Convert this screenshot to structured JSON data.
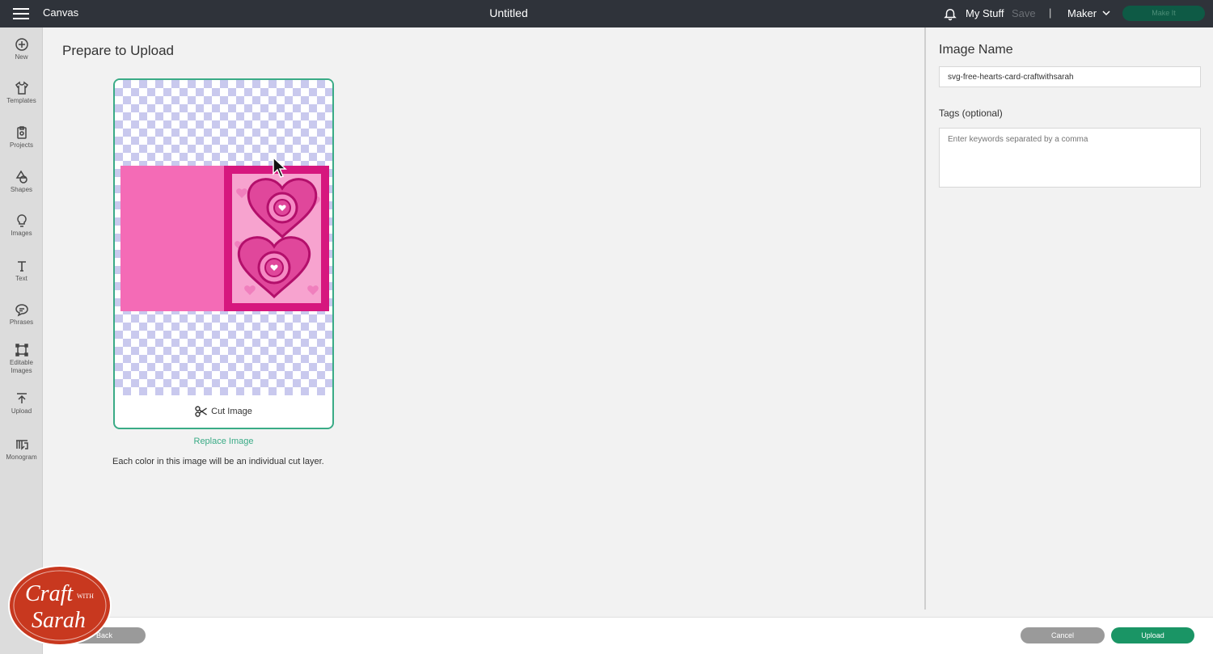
{
  "topbar": {
    "app_name": "Canvas",
    "document_title": "Untitled",
    "my_stuff": "My Stuff",
    "save": "Save",
    "separator": "|",
    "machine": "Maker",
    "make_it": "Make It"
  },
  "sidebar": {
    "items": [
      {
        "label": "New",
        "icon": "plus-circle-icon"
      },
      {
        "label": "Templates",
        "icon": "tshirt-icon"
      },
      {
        "label": "Projects",
        "icon": "projects-icon"
      },
      {
        "label": "Shapes",
        "icon": "shapes-icon"
      },
      {
        "label": "Images",
        "icon": "lightbulb-icon"
      },
      {
        "label": "Text",
        "icon": "text-icon"
      },
      {
        "label": "Phrases",
        "icon": "speech-bubble-icon"
      },
      {
        "label": "Editable Images",
        "icon": "editable-images-icon"
      },
      {
        "label": "Upload",
        "icon": "upload-icon"
      },
      {
        "label": "Monogram",
        "icon": "monogram-icon"
      }
    ]
  },
  "main": {
    "title": "Prepare to Upload",
    "cut_image_label": "Cut Image",
    "replace_image": "Replace Image",
    "note": "Each color in this image will be an individual cut layer."
  },
  "right_panel": {
    "image_name_label": "Image Name",
    "image_name_value": "svg-free-hearts-card-craftwithsarah",
    "tags_label": "Tags (optional)",
    "tags_placeholder": "Enter keywords separated by a comma"
  },
  "footer": {
    "back": "Back",
    "cancel": "Cancel",
    "upload": "Upload"
  },
  "watermark": {
    "line1": "Craft",
    "with": "WITH",
    "line2": "Sarah"
  },
  "colors": {
    "accent": "#3aab86",
    "upload_button": "#1a9565",
    "topbar": "#2f333a",
    "card_pink_light": "#f46bb6",
    "card_pink_dark": "#d6177e",
    "logo_red": "#c8381f"
  }
}
